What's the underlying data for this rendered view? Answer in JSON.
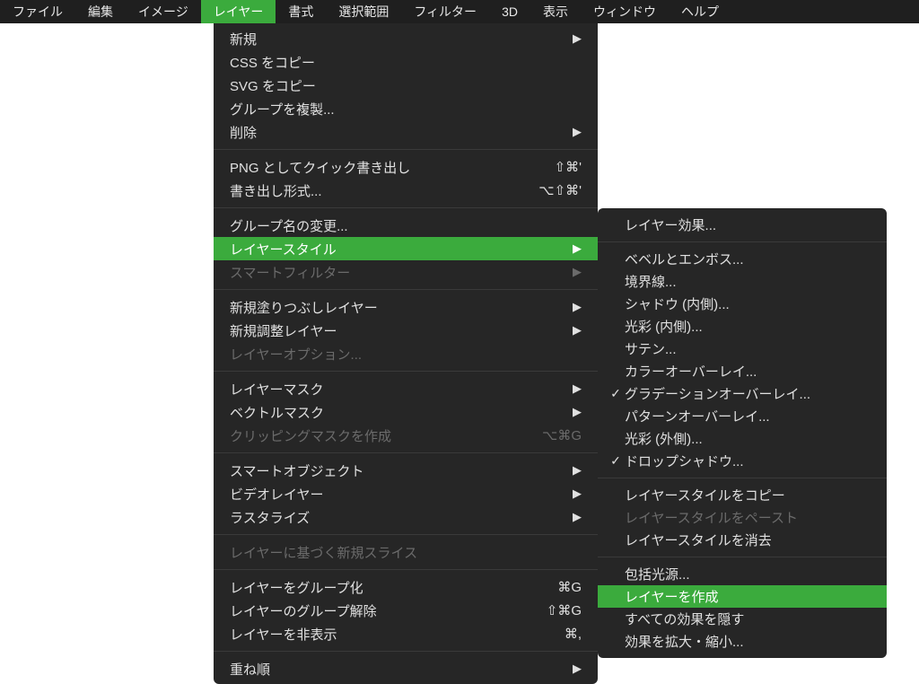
{
  "menubar": {
    "file": "ファイル",
    "edit": "編集",
    "image": "イメージ",
    "layer": "レイヤー",
    "type": "書式",
    "select": "選択範囲",
    "filter": "フィルター",
    "threeD": "3D",
    "view": "表示",
    "window": "ウィンドウ",
    "help": "ヘルプ"
  },
  "layerMenu": {
    "new": "新規",
    "copyCSS": "CSS をコピー",
    "copySVG": "SVG をコピー",
    "duplicateGroup": "グループを複製...",
    "delete": "削除",
    "quickExportPNG": "PNG としてクイック書き出し",
    "quickExportPNG_sc": "⇧⌘'",
    "exportAs": "書き出し形式...",
    "exportAs_sc": "⌥⇧⌘'",
    "renameGroup": "グループ名の変更...",
    "layerStyle": "レイヤースタイル",
    "smartFilter": "スマートフィルター",
    "newFillLayer": "新規塗りつぶしレイヤー",
    "newAdjustLayer": "新規調整レイヤー",
    "layerOptions": "レイヤーオプション...",
    "layerMask": "レイヤーマスク",
    "vectorMask": "ベクトルマスク",
    "createClippingMask": "クリッピングマスクを作成",
    "createClippingMask_sc": "⌥⌘G",
    "smartObjects": "スマートオブジェクト",
    "videoLayers": "ビデオレイヤー",
    "rasterize": "ラスタライズ",
    "newSliceFromLayer": "レイヤーに基づく新規スライス",
    "groupLayers": "レイヤーをグループ化",
    "groupLayers_sc": "⌘G",
    "ungroupLayers": "レイヤーのグループ解除",
    "ungroupLayers_sc": "⇧⌘G",
    "hideLayers": "レイヤーを非表示",
    "hideLayers_sc": "⌘,",
    "arrange": "重ね順"
  },
  "styleMenu": {
    "layerEffects": "レイヤー効果...",
    "bevelEmboss": "ベベルとエンボス...",
    "stroke": "境界線...",
    "innerShadow": "シャドウ (内側)...",
    "innerGlow": "光彩 (内側)...",
    "satin": "サテン...",
    "colorOverlay": "カラーオーバーレイ...",
    "gradientOverlay": "グラデーションオーバーレイ...",
    "patternOverlay": "パターンオーバーレイ...",
    "outerGlow": "光彩 (外側)...",
    "dropShadow": "ドロップシャドウ...",
    "copyLayerStyle": "レイヤースタイルをコピー",
    "pasteLayerStyle": "レイヤースタイルをペースト",
    "clearLayerStyle": "レイヤースタイルを消去",
    "globalLight": "包括光源...",
    "createLayer": "レイヤーを作成",
    "hideAllEffects": "すべての効果を隠す",
    "scaleEffects": "効果を拡大・縮小..."
  }
}
